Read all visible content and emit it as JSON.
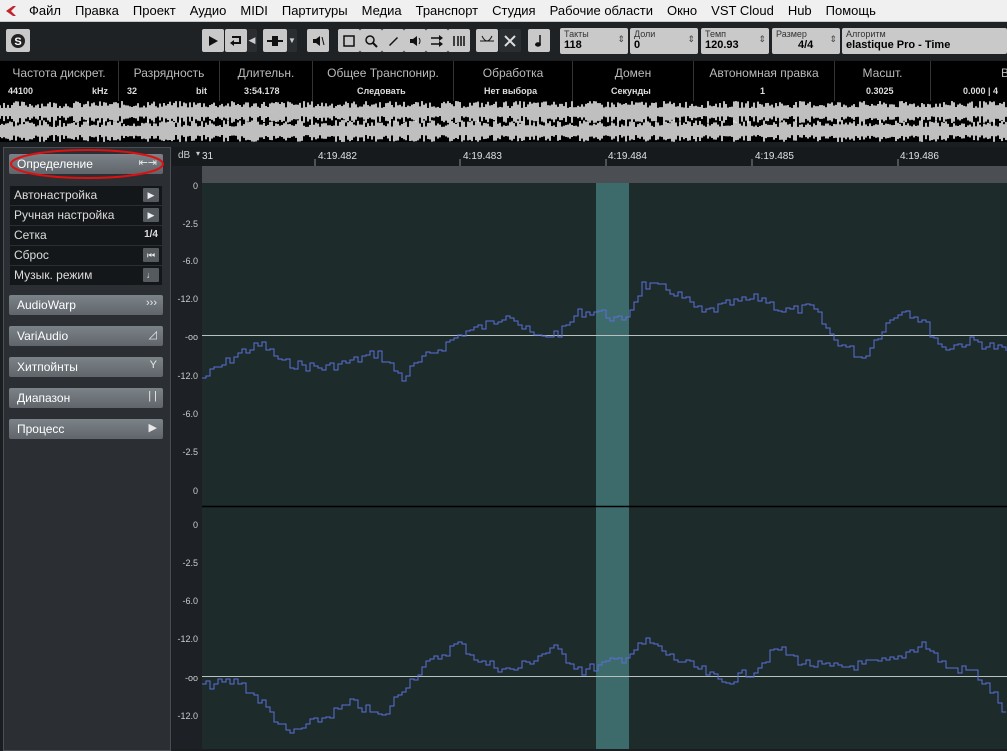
{
  "menu": {
    "items": [
      "Файл",
      "Правка",
      "Проект",
      "Аудио",
      "MIDI",
      "Партитуры",
      "Медиа",
      "Транспорт",
      "Студия",
      "Рабочие области",
      "Окно",
      "VST Cloud",
      "Hub",
      "Помощь"
    ]
  },
  "toolbar": {
    "fields": [
      {
        "label": "Такты",
        "value": "118"
      },
      {
        "label": "Доли",
        "value": "0"
      },
      {
        "label": "Темп",
        "value": "120.93"
      },
      {
        "label": "Размер",
        "value": "4/4"
      },
      {
        "label": "Алгоритм",
        "value": "elastique Pro - Time"
      }
    ]
  },
  "infoline": {
    "columns": [
      {
        "header": "Частота дискрет.",
        "value": "44100",
        "unit": "kHz"
      },
      {
        "header": "Разрядность",
        "value": "32",
        "unit": "bit"
      },
      {
        "header": "Длительн.",
        "value": "3:54.178",
        "unit": ""
      },
      {
        "header": "Общее Транспонир.",
        "value": "Следовать",
        "unit": ""
      },
      {
        "header": "Обработка",
        "value": "Нет выбора",
        "unit": ""
      },
      {
        "header": "Домен",
        "value": "Секунды",
        "unit": ""
      },
      {
        "header": "Автономная правка",
        "value": "1",
        "unit": ""
      },
      {
        "header": "Масшт.",
        "value": "0.3025",
        "unit": ""
      },
      {
        "header": "В",
        "value": "0.000 | 4",
        "unit": ""
      }
    ]
  },
  "panel": {
    "definition": {
      "label": "Определение"
    },
    "items": [
      {
        "label": "Автонастройка",
        "icon": "play-icon"
      },
      {
        "label": "Ручная настройка",
        "icon": "play-icon"
      },
      {
        "label": "Сетка",
        "value": "1/4"
      },
      {
        "label": "Сброс",
        "icon": "reset-icon"
      },
      {
        "label": "Музык. режим",
        "icon": "note-icon"
      }
    ],
    "sections": [
      {
        "label": "AudioWarp",
        "icon": "forward-icon"
      },
      {
        "label": "VariAudio",
        "icon": "variaudio-icon"
      },
      {
        "label": "Хитпойнты",
        "icon": "hitpoint-icon"
      },
      {
        "label": "Диапазон",
        "icon": "range-icon"
      },
      {
        "label": "Процесс",
        "icon": "play-icon"
      }
    ]
  },
  "editor": {
    "db_header": "dB",
    "ruler_ticks": [
      "31",
      "4:19.482",
      "4:19.483",
      "4:19.484",
      "4:19.485",
      "4:19.486"
    ],
    "db_labels_top": [
      "0",
      "-2.5",
      "-6.0",
      "-12.0",
      "-oo",
      "-12.0",
      "-6.0",
      "-2.5",
      "0"
    ],
    "db_labels_bottom": [
      "0",
      "-2.5",
      "-6.0",
      "-12.0",
      "-oo",
      "-12.0"
    ]
  },
  "colors": {
    "waveform": "#5b6fd8",
    "selection": "#3d6b6b",
    "canvas": "#1e2b2b",
    "highlight_circle": "#e01010"
  }
}
